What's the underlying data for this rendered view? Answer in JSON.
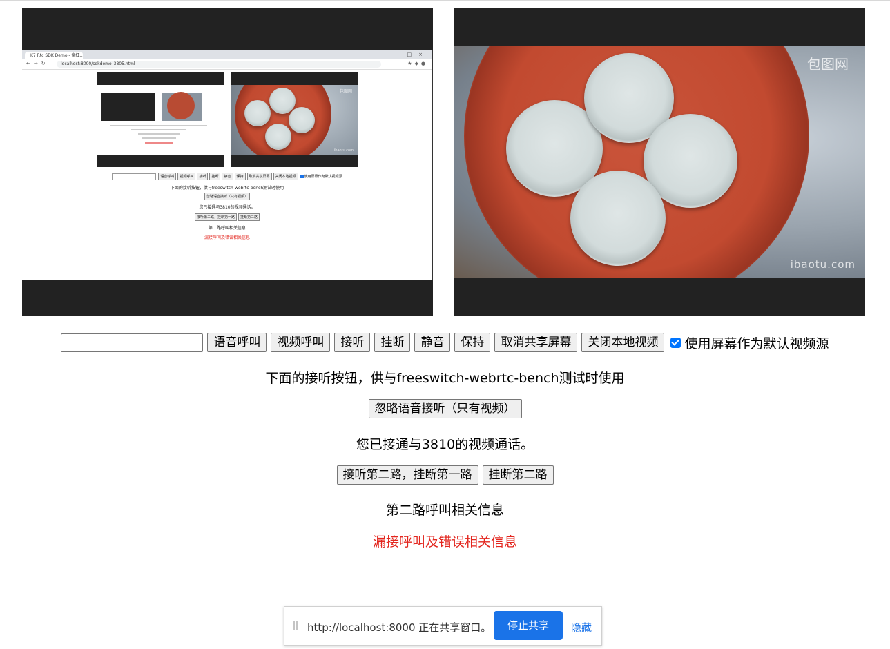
{
  "local_preview": {
    "tab_title": "K7 Rtc SDK Demo - 金红...",
    "url": "localhost:8000/sdkdemo_3805.html",
    "input_row": [
      "语音呼叫",
      "视频呼叫",
      "接听",
      "挂断",
      "静音",
      "保持",
      "取消共享屏幕",
      "关闭本地视频"
    ],
    "checkbox_label": "使用屏幕作为默认视频源",
    "bench_note": "下面的接听按钮，供与freeswitch-webrtc-bench测试时使用",
    "ignore_audio": "忽略语音接听（只有视频）",
    "status": "您已接通与3810的视频通话。",
    "line_buttons": [
      "接听第二路，挂断第一路",
      "挂断第二路"
    ],
    "second_line_info": "第二路呼叫相关信息",
    "missed_info": "漏接呼叫及错误相关信息"
  },
  "remote_video": {
    "watermark_top": "包图网",
    "watermark_bottom": "ibaotu.com"
  },
  "controls": {
    "number_input_value": "",
    "voice_call": "语音呼叫",
    "video_call": "视频呼叫",
    "answer": "接听",
    "hangup": "挂断",
    "mute": "静音",
    "hold": "保持",
    "cancel_share": "取消共享屏幕",
    "close_local_video": "关闭本地视频",
    "screen_default_checked": true,
    "screen_default_label": "使用屏幕作为默认视频源"
  },
  "bench_note": "下面的接听按钮，供与freeswitch-webrtc-bench测试时使用",
  "ignore_audio_answer": "忽略语音接听（只有视频）",
  "call_status": "您已接通与3810的视频通话。",
  "answer_second_hangup_first": "接听第二路，挂断第一路",
  "hangup_second": "挂断第二路",
  "second_line_info": "第二路呼叫相关信息",
  "missed_call_info": "漏接呼叫及错误相关信息",
  "share_bar": {
    "message": "http://localhost:8000 正在共享窗口。",
    "stop_button": "停止共享",
    "hide_link": "隐藏"
  },
  "colors": {
    "video_bg": "#222222",
    "error_text": "#e3261e",
    "accent": "#1a73e8"
  }
}
